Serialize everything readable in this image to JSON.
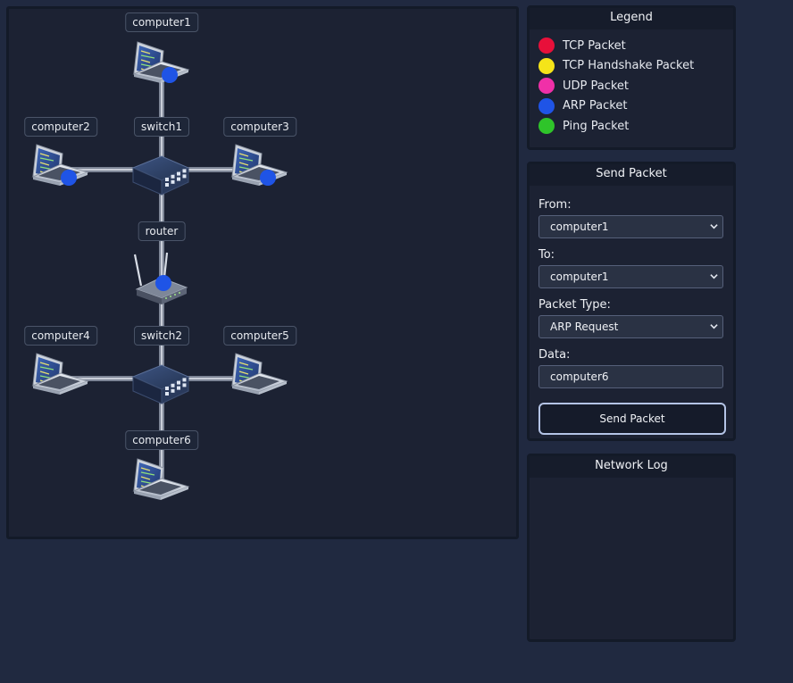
{
  "topology": {
    "nodes": [
      {
        "id": "computer1",
        "label": "computer1",
        "kind": "computer",
        "has_packet": true,
        "packet_color": "#1f54e6"
      },
      {
        "id": "switch1",
        "label": "switch1",
        "kind": "switch",
        "has_packet": false
      },
      {
        "id": "computer2",
        "label": "computer2",
        "kind": "computer",
        "has_packet": true,
        "packet_color": "#1f54e6"
      },
      {
        "id": "computer3",
        "label": "computer3",
        "kind": "computer",
        "has_packet": true,
        "packet_color": "#1f54e6"
      },
      {
        "id": "router",
        "label": "router",
        "kind": "router",
        "has_packet": true,
        "packet_color": "#1f54e6"
      },
      {
        "id": "switch2",
        "label": "switch2",
        "kind": "switch",
        "has_packet": false
      },
      {
        "id": "computer4",
        "label": "computer4",
        "kind": "computer",
        "has_packet": false
      },
      {
        "id": "computer5",
        "label": "computer5",
        "kind": "computer",
        "has_packet": false
      },
      {
        "id": "computer6",
        "label": "computer6",
        "kind": "computer",
        "has_packet": false
      }
    ],
    "links": [
      [
        "computer1",
        "switch1"
      ],
      [
        "computer2",
        "switch1"
      ],
      [
        "computer3",
        "switch1"
      ],
      [
        "switch1",
        "router"
      ],
      [
        "router",
        "switch2"
      ],
      [
        "computer4",
        "switch2"
      ],
      [
        "computer5",
        "switch2"
      ],
      [
        "computer6",
        "switch2"
      ]
    ]
  },
  "legend": {
    "title": "Legend",
    "items": [
      {
        "label": "TCP Packet",
        "color": "#e8103a"
      },
      {
        "label": "TCP Handshake Packet",
        "color": "#f5e419"
      },
      {
        "label": "UDP Packet",
        "color": "#f030a8"
      },
      {
        "label": "ARP Packet",
        "color": "#1f54e6"
      },
      {
        "label": "Ping Packet",
        "color": "#2fc42a"
      }
    ]
  },
  "send_packet": {
    "title": "Send Packet",
    "from_label": "From:",
    "from_value": "computer1",
    "to_label": "To:",
    "to_value": "computer1",
    "type_label": "Packet Type:",
    "type_value": "ARP Request",
    "data_label": "Data:",
    "data_value": "computer6",
    "button_label": "Send Packet"
  },
  "network_log": {
    "title": "Network Log",
    "entries": []
  },
  "icons": {
    "computer": "laptop-icon",
    "switch": "network-switch-icon",
    "router": "wifi-router-icon",
    "dropdown": "chevron-down-icon"
  }
}
